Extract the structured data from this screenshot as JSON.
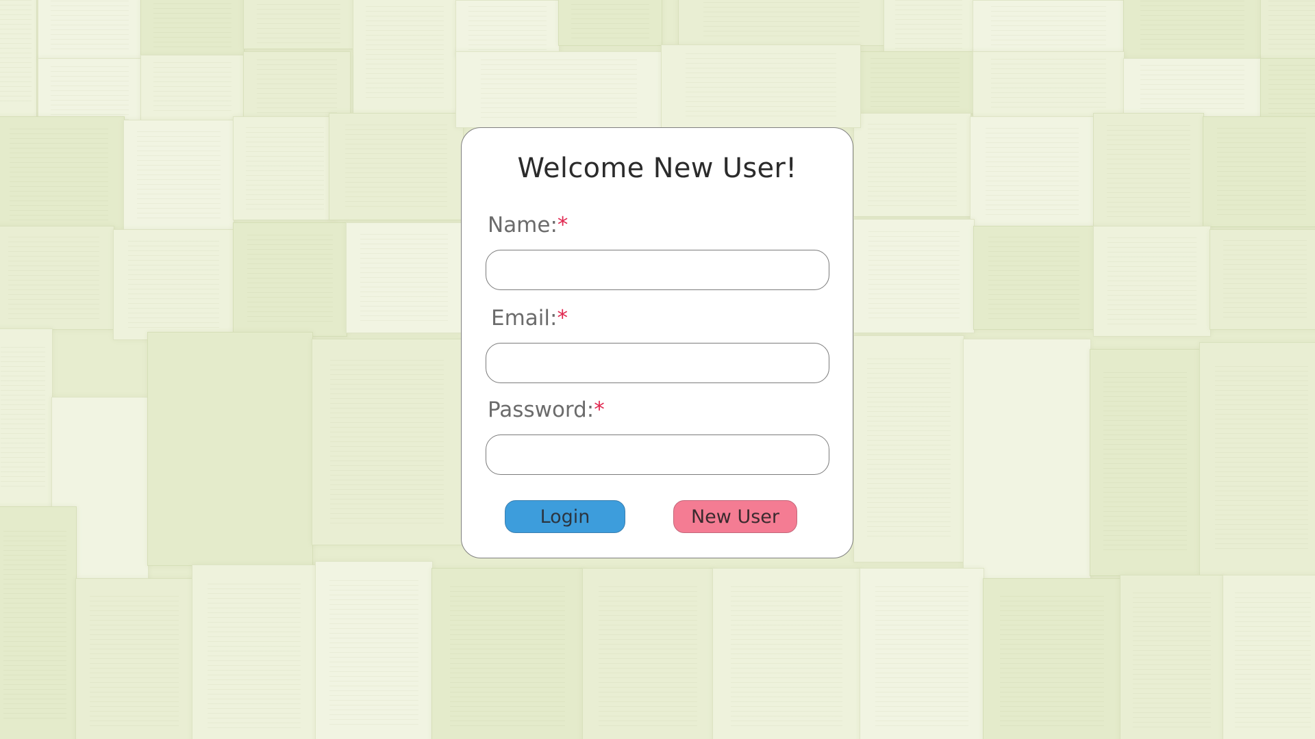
{
  "form": {
    "title": "Welcome New User!",
    "fields": [
      {
        "label": "Name:",
        "required_mark": "*",
        "value": "",
        "placeholder": ""
      },
      {
        "label": "Email:",
        "required_mark": "*",
        "value": "",
        "placeholder": ""
      },
      {
        "label": "Password:",
        "required_mark": "*",
        "value": "",
        "placeholder": ""
      }
    ],
    "buttons": {
      "login_label": "Login",
      "new_user_label": "New User"
    }
  },
  "colors": {
    "background": "#e7edcf",
    "card": "#ffffff",
    "required": "#e0274f",
    "login_button": "#3d9ddc",
    "new_user_button": "#f47c93"
  }
}
